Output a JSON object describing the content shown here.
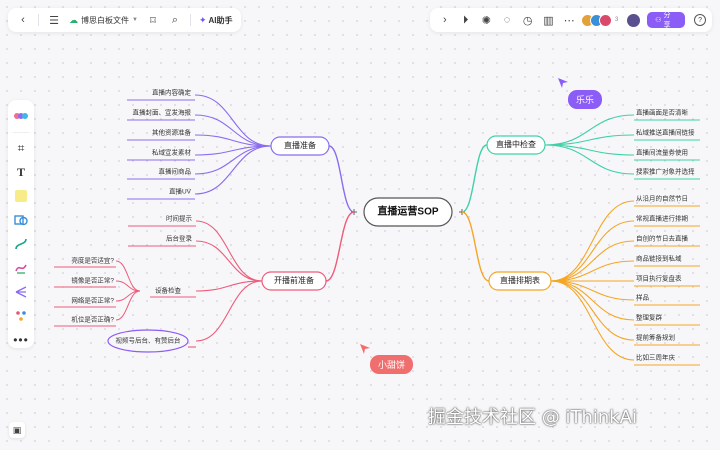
{
  "topbar": {
    "file_title": "博思白板文件",
    "ai_label": "AI助手",
    "collaborators_count": "3",
    "share_label": "分享"
  },
  "mindmap": {
    "root": "直播运营SOP",
    "branches": [
      {
        "label": "直播准备",
        "side": "left",
        "color": "#8b6cf0",
        "children": [
          "直播内容确定",
          "直播封面、宣发海报",
          "其他资源准备",
          "私域宣发素材",
          "直播间商品",
          "直播UV"
        ]
      },
      {
        "label": "开播前准备",
        "side": "left",
        "color": "#ee5b7b",
        "children": [
          "时间提示",
          "后台登录",
          {
            "label": "设备检查",
            "children": [
              "亮度是否适宜?",
              "镜像是否正常?",
              "网络是否正常?",
              "机位是否正确?"
            ]
          },
          "视频号后台、有赞后台"
        ]
      },
      {
        "label": "直播中检查",
        "side": "right",
        "color": "#3fd1a7",
        "children": [
          "直播画面是否清晰",
          "私域推送直播间链接",
          "直播间流量券使用",
          "搜索推广对象并选择"
        ]
      },
      {
        "label": "直播排期表",
        "side": "right",
        "color": "#f5a623",
        "children": [
          "从沿月的自然节日",
          "常规直播进行排期",
          "自创的节日去直播",
          "商品链接到私域",
          "项目执行复盘表",
          "样品",
          "整理复群",
          "提前筹备规划",
          "比如三周年庆"
        ]
      }
    ]
  },
  "cursors": [
    {
      "name": "乐乐",
      "color": "#8b5cf6"
    },
    {
      "name": "小甜饼",
      "color": "#f06e6e"
    }
  ],
  "watermark": "掘金技术社区 @ iThinkAi"
}
